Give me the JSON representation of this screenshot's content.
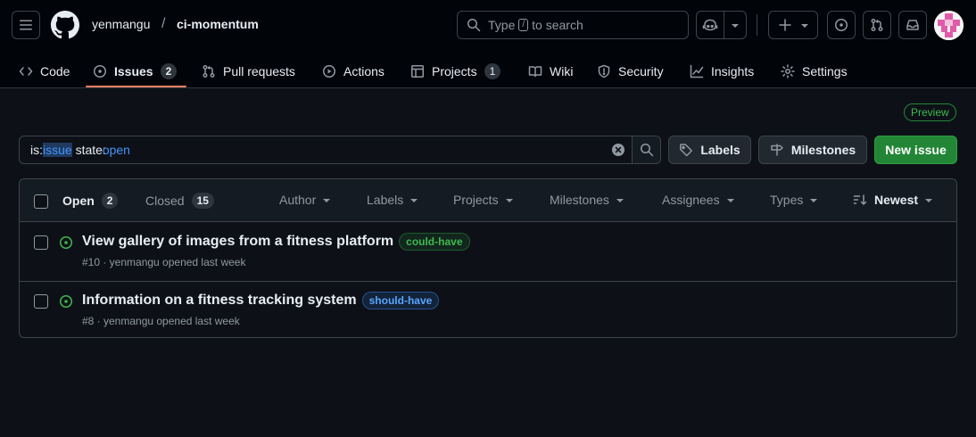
{
  "header": {
    "owner": "yenmangu",
    "separator": "/",
    "repo": "ci-momentum",
    "search_prefix": "Type",
    "search_key": "/",
    "search_suffix": "to search"
  },
  "nav": {
    "tabs": [
      {
        "label": "Code",
        "icon": "code-icon"
      },
      {
        "label": "Issues",
        "icon": "issue-opened-icon",
        "counter": "2",
        "active": true
      },
      {
        "label": "Pull requests",
        "icon": "git-pull-request-icon"
      },
      {
        "label": "Actions",
        "icon": "play-icon"
      },
      {
        "label": "Projects",
        "icon": "table-icon",
        "counter": "1"
      },
      {
        "label": "Wiki",
        "icon": "book-icon"
      },
      {
        "label": "Security",
        "icon": "shield-icon"
      },
      {
        "label": "Insights",
        "icon": "graph-icon"
      },
      {
        "label": "Settings",
        "icon": "gear-icon"
      }
    ]
  },
  "preview_badge": "Preview",
  "filter": {
    "qualifier1_key": "is:",
    "qualifier1_value": "issue",
    "qualifier2_key": "state:",
    "qualifier2_value": "open"
  },
  "buttons": {
    "labels": "Labels",
    "milestones": "Milestones",
    "new_issue": "New issue"
  },
  "list_header": {
    "open_label": "Open",
    "open_count": "2",
    "closed_label": "Closed",
    "closed_count": "15",
    "filters": [
      "Author",
      "Labels",
      "Projects",
      "Milestones",
      "Assignees",
      "Types"
    ],
    "sort_label": "Newest"
  },
  "issues": [
    {
      "title": "View gallery of images from a fitness platform",
      "label": "could-have",
      "label_color": "#3fb950",
      "meta": "#10 · yenmangu opened last week"
    },
    {
      "title": "Information on a fitness tracking system",
      "label": "should-have",
      "label_color": "#58a6ff",
      "meta": "#8 · yenmangu opened last week"
    }
  ],
  "colors": {
    "accent_underline": "#f78166",
    "primary_button": "#238636",
    "open_icon": "#3fb950"
  }
}
